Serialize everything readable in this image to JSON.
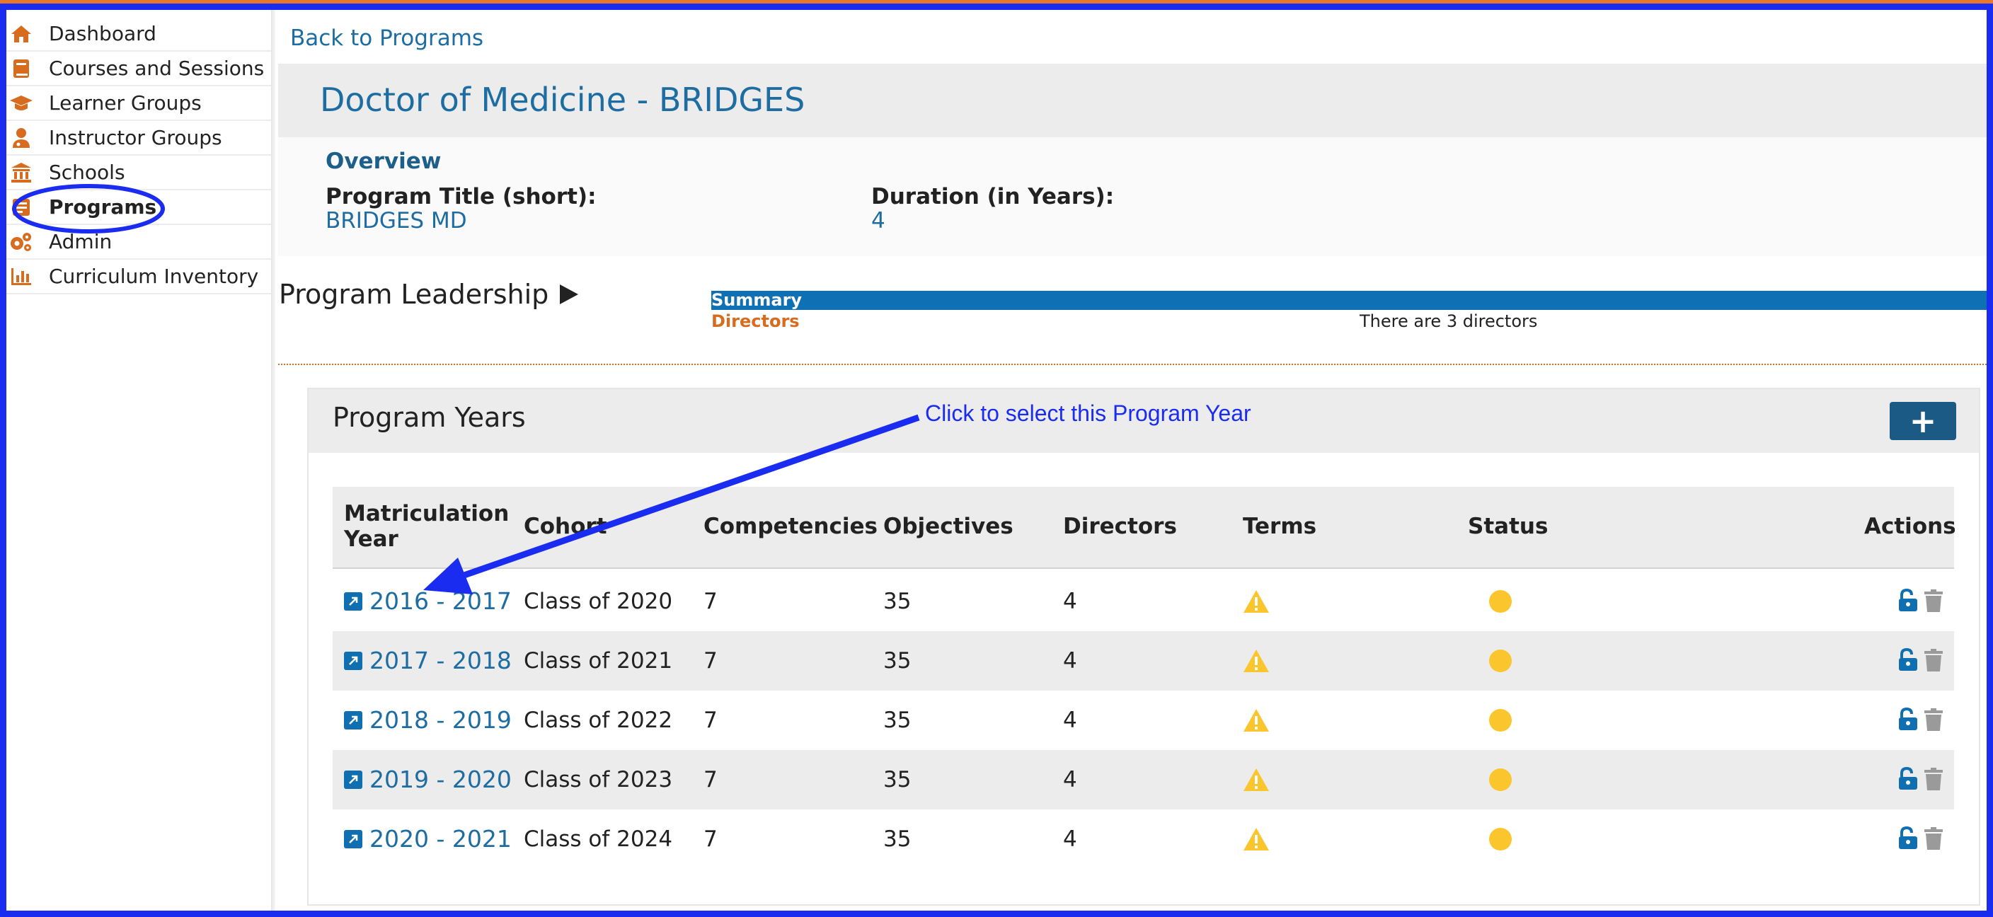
{
  "sidebar": {
    "items": [
      {
        "label": "Dashboard",
        "icon": "home-icon"
      },
      {
        "label": "Courses and Sessions",
        "icon": "book-icon"
      },
      {
        "label": "Learner Groups",
        "icon": "graduation-cap-icon"
      },
      {
        "label": "Instructor Groups",
        "icon": "user-md-icon"
      },
      {
        "label": "Schools",
        "icon": "university-icon"
      },
      {
        "label": "Programs",
        "icon": "programs-icon",
        "active": true
      },
      {
        "label": "Admin",
        "icon": "gears-icon"
      },
      {
        "label": "Curriculum Inventory",
        "icon": "bar-chart-icon"
      }
    ]
  },
  "header": {
    "back_link": "Back to Programs",
    "title": "Doctor of Medicine - BRIDGES"
  },
  "overview": {
    "title": "Overview",
    "short_title_label": "Program Title (short):",
    "short_title_value": "BRIDGES MD",
    "duration_label": "Duration (in Years):",
    "duration_value": "4"
  },
  "leadership": {
    "title": "Program Leadership",
    "summary_label": "Summary",
    "directors_label": "Directors",
    "directors_summary": "There are 3 directors"
  },
  "program_years": {
    "title": "Program Years",
    "add_label": "+",
    "columns": [
      "Matriculation Year",
      "Cohort",
      "Competencies",
      "Objectives",
      "Directors",
      "Terms",
      "Status",
      "Actions"
    ],
    "rows": [
      {
        "year": "2016 - 2017",
        "cohort": "Class of 2020",
        "competencies": "7",
        "objectives": "35",
        "directors": "4"
      },
      {
        "year": "2017 - 2018",
        "cohort": "Class of 2021",
        "competencies": "7",
        "objectives": "35",
        "directors": "4"
      },
      {
        "year": "2018 - 2019",
        "cohort": "Class of 2022",
        "competencies": "7",
        "objectives": "35",
        "directors": "4"
      },
      {
        "year": "2019 - 2020",
        "cohort": "Class of 2023",
        "competencies": "7",
        "objectives": "35",
        "directors": "4"
      },
      {
        "year": "2020 - 2021",
        "cohort": "Class of 2024",
        "competencies": "7",
        "objectives": "35",
        "directors": "4"
      }
    ]
  },
  "annotation": {
    "text": "Click to select this Program Year"
  },
  "colors": {
    "accent_blue": "#1d6da3",
    "annotation_blue": "#1a2cf0",
    "icon_orange": "#d76c1e",
    "status_yellow": "#fbc52e"
  }
}
